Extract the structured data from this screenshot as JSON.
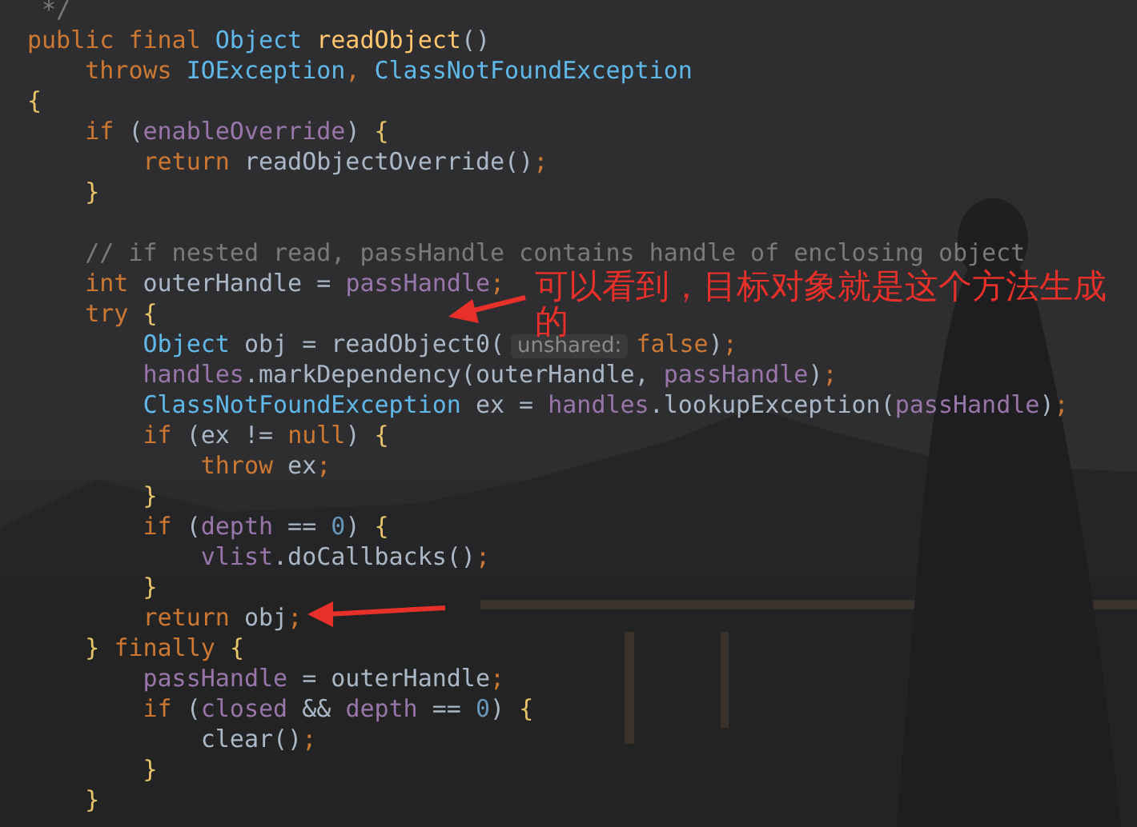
{
  "code_lines": [
    {
      "kind": "code",
      "tokens": [
        {
          "kind": "comment",
          "text": " */"
        }
      ]
    },
    {
      "kind": "code",
      "tokens": [
        {
          "kind": "keyword",
          "text": "public final "
        },
        {
          "kind": "type",
          "text": "Object "
        },
        {
          "kind": "method",
          "text": "readObject"
        },
        {
          "kind": "plain",
          "text": "()"
        }
      ]
    },
    {
      "kind": "code",
      "tokens": [
        {
          "kind": "keyword",
          "text": "    throws "
        },
        {
          "kind": "type",
          "text": "IOException"
        },
        {
          "kind": "keyword",
          "text": ", "
        },
        {
          "kind": "type",
          "text": "ClassNotFoundException"
        }
      ]
    },
    {
      "kind": "code",
      "tokens": [
        {
          "kind": "brace",
          "text": "{"
        }
      ]
    },
    {
      "kind": "code",
      "tokens": [
        {
          "kind": "keyword",
          "text": "    if"
        },
        {
          "kind": "plain",
          "text": " ("
        },
        {
          "kind": "field",
          "text": "enableOverride"
        },
        {
          "kind": "plain",
          "text": ") "
        },
        {
          "kind": "brace",
          "text": "{"
        }
      ]
    },
    {
      "kind": "code",
      "tokens": [
        {
          "kind": "keyword",
          "text": "        return"
        },
        {
          "kind": "plain",
          "text": " readObjectOverride()"
        },
        {
          "kind": "keyword",
          "text": ";"
        }
      ]
    },
    {
      "kind": "code",
      "tokens": [
        {
          "kind": "brace",
          "text": "    }"
        }
      ]
    },
    {
      "kind": "blank"
    },
    {
      "kind": "code",
      "tokens": [
        {
          "kind": "comment",
          "text": "    // if nested read, passHandle contains handle of enclosing object"
        }
      ]
    },
    {
      "kind": "code",
      "tokens": [
        {
          "kind": "keyword",
          "text": "    int"
        },
        {
          "kind": "plain",
          "text": " outerHandle = "
        },
        {
          "kind": "field",
          "text": "passHandle"
        },
        {
          "kind": "keyword",
          "text": ";"
        }
      ]
    },
    {
      "kind": "code",
      "tokens": [
        {
          "kind": "keyword",
          "text": "    try "
        },
        {
          "kind": "brace",
          "text": "{"
        }
      ]
    },
    {
      "kind": "code",
      "tokens": [
        {
          "kind": "type",
          "text": "        Object"
        },
        {
          "kind": "plain",
          "text": " obj = readObject0("
        },
        {
          "kind": "hint",
          "text": "unshared:"
        },
        {
          "kind": "keyword",
          "text": "false"
        },
        {
          "kind": "plain",
          "text": ")"
        },
        {
          "kind": "keyword",
          "text": ";"
        }
      ]
    },
    {
      "kind": "code",
      "tokens": [
        {
          "kind": "field",
          "text": "        handles"
        },
        {
          "kind": "plain",
          "text": ".markDependency(outerHandle, "
        },
        {
          "kind": "field",
          "text": "passHandle"
        },
        {
          "kind": "plain",
          "text": ")"
        },
        {
          "kind": "keyword",
          "text": ";"
        }
      ]
    },
    {
      "kind": "code",
      "tokens": [
        {
          "kind": "type",
          "text": "        ClassNotFoundException"
        },
        {
          "kind": "plain",
          "text": " ex = "
        },
        {
          "kind": "field",
          "text": "handles"
        },
        {
          "kind": "plain",
          "text": ".lookupException("
        },
        {
          "kind": "field",
          "text": "passHandle"
        },
        {
          "kind": "plain",
          "text": ")"
        },
        {
          "kind": "keyword",
          "text": ";"
        }
      ]
    },
    {
      "kind": "code",
      "tokens": [
        {
          "kind": "keyword",
          "text": "        if"
        },
        {
          "kind": "plain",
          "text": " (ex != "
        },
        {
          "kind": "keyword",
          "text": "null"
        },
        {
          "kind": "plain",
          "text": ") "
        },
        {
          "kind": "brace",
          "text": "{"
        }
      ]
    },
    {
      "kind": "code",
      "tokens": [
        {
          "kind": "keyword",
          "text": "            throw"
        },
        {
          "kind": "plain",
          "text": " ex"
        },
        {
          "kind": "keyword",
          "text": ";"
        }
      ]
    },
    {
      "kind": "code",
      "tokens": [
        {
          "kind": "brace",
          "text": "        }"
        }
      ]
    },
    {
      "kind": "code",
      "tokens": [
        {
          "kind": "keyword",
          "text": "        if"
        },
        {
          "kind": "plain",
          "text": " ("
        },
        {
          "kind": "field",
          "text": "depth"
        },
        {
          "kind": "plain",
          "text": " == "
        },
        {
          "kind": "number",
          "text": "0"
        },
        {
          "kind": "plain",
          "text": ") "
        },
        {
          "kind": "brace",
          "text": "{"
        }
      ]
    },
    {
      "kind": "code",
      "tokens": [
        {
          "kind": "field",
          "text": "            vlist"
        },
        {
          "kind": "plain",
          "text": ".doCallbacks()"
        },
        {
          "kind": "keyword",
          "text": ";"
        }
      ]
    },
    {
      "kind": "code",
      "tokens": [
        {
          "kind": "brace",
          "text": "        }"
        }
      ]
    },
    {
      "kind": "code",
      "tokens": [
        {
          "kind": "keyword",
          "text": "        return"
        },
        {
          "kind": "plain",
          "text": " obj"
        },
        {
          "kind": "keyword",
          "text": ";"
        }
      ]
    },
    {
      "kind": "code",
      "tokens": [
        {
          "kind": "brace",
          "text": "    } "
        },
        {
          "kind": "keyword",
          "text": "finally "
        },
        {
          "kind": "brace",
          "text": "{"
        }
      ]
    },
    {
      "kind": "code",
      "tokens": [
        {
          "kind": "field",
          "text": "        passHandle"
        },
        {
          "kind": "plain",
          "text": " = outerHandle"
        },
        {
          "kind": "keyword",
          "text": ";"
        }
      ]
    },
    {
      "kind": "code",
      "tokens": [
        {
          "kind": "keyword",
          "text": "        if"
        },
        {
          "kind": "plain",
          "text": " ("
        },
        {
          "kind": "field",
          "text": "closed"
        },
        {
          "kind": "plain",
          "text": " && "
        },
        {
          "kind": "field",
          "text": "depth"
        },
        {
          "kind": "plain",
          "text": " == "
        },
        {
          "kind": "number",
          "text": "0"
        },
        {
          "kind": "plain",
          "text": ") "
        },
        {
          "kind": "brace",
          "text": "{"
        }
      ]
    },
    {
      "kind": "code",
      "tokens": [
        {
          "kind": "plain",
          "text": "            clear()"
        },
        {
          "kind": "keyword",
          "text": ";"
        }
      ]
    },
    {
      "kind": "code",
      "tokens": [
        {
          "kind": "brace",
          "text": "        }"
        }
      ]
    },
    {
      "kind": "code",
      "tokens": [
        {
          "kind": "brace",
          "text": "    }"
        }
      ]
    }
  ],
  "annotation": {
    "text": "可以看到，目标对象就是这个方法生成的"
  }
}
